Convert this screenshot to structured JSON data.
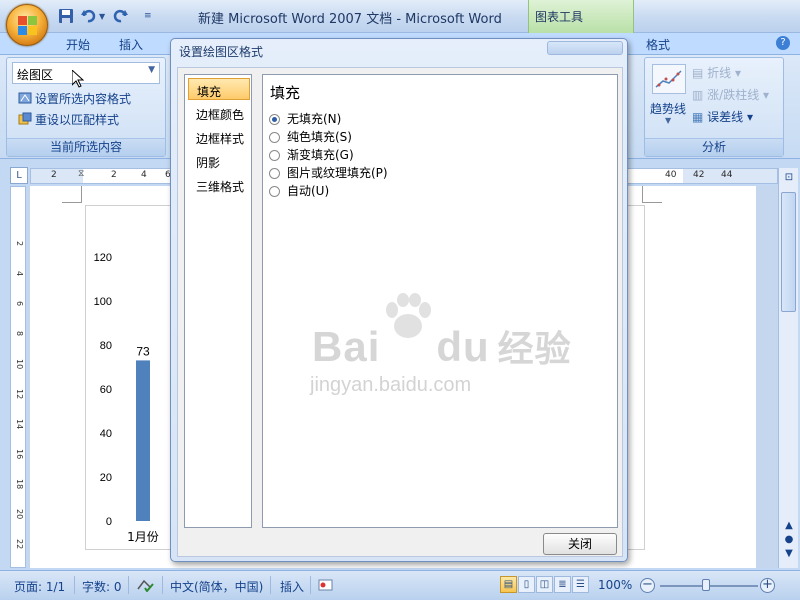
{
  "titlebar": {
    "title": "新建 Microsoft Word 2007 文档 - Microsoft Word",
    "context_tool": "图表工具"
  },
  "tabs": {
    "home": "开始",
    "insert": "插入",
    "format": "格式"
  },
  "ribbon": {
    "current_selection": {
      "combo_value": "绘图区",
      "format_selection": "设置所选内容格式",
      "reset_style": "重设以匹配样式",
      "group_label": "当前所选内容"
    },
    "analysis": {
      "trendline": "趋势线",
      "lines": "折线",
      "updown_bars": "涨/跌柱线",
      "error_bars": "误差线",
      "group_label": "分析"
    }
  },
  "ruler": {
    "corner": "L",
    "left_nums": [
      "2",
      "2",
      "4",
      "6"
    ],
    "right_nums": [
      "40",
      "42",
      "44"
    ],
    "v_nums": [
      "2",
      "4",
      "6",
      "8",
      "10",
      "12",
      "14",
      "16",
      "18",
      "20",
      "22"
    ]
  },
  "chart_data": {
    "type": "bar",
    "categories": [
      "1月份"
    ],
    "values": [
      73
    ],
    "data_labels": [
      "73"
    ],
    "yticks": [
      0,
      20,
      40,
      60,
      80,
      100,
      120
    ],
    "ylim": [
      0,
      130
    ],
    "bar_color": "#4f81bd"
  },
  "dialog": {
    "title": "设置绘图区格式",
    "nav_items": [
      "填充",
      "边框颜色",
      "边框样式",
      "阴影",
      "三维格式"
    ],
    "selected_nav": 0,
    "heading": "填充",
    "options": [
      "无填充(N)",
      "纯色填充(S)",
      "渐变填充(G)",
      "图片或纹理填充(P)",
      "自动(U)"
    ],
    "selected_option": 0,
    "close_label": "关闭"
  },
  "watermark": {
    "text": "Bai",
    "text2": "du",
    "text3": "经验",
    "sub": "jingyan.baidu.com"
  },
  "statusbar": {
    "page": "页面: 1/1",
    "words": "字数: 0",
    "language": "中文(简体，中国)",
    "insert_mode": "插入",
    "zoom": "100%"
  },
  "colors": {
    "accent": "#15428b",
    "selected_nav_bg": "#ffcb6b",
    "context_tool": "#b9e0a7"
  }
}
